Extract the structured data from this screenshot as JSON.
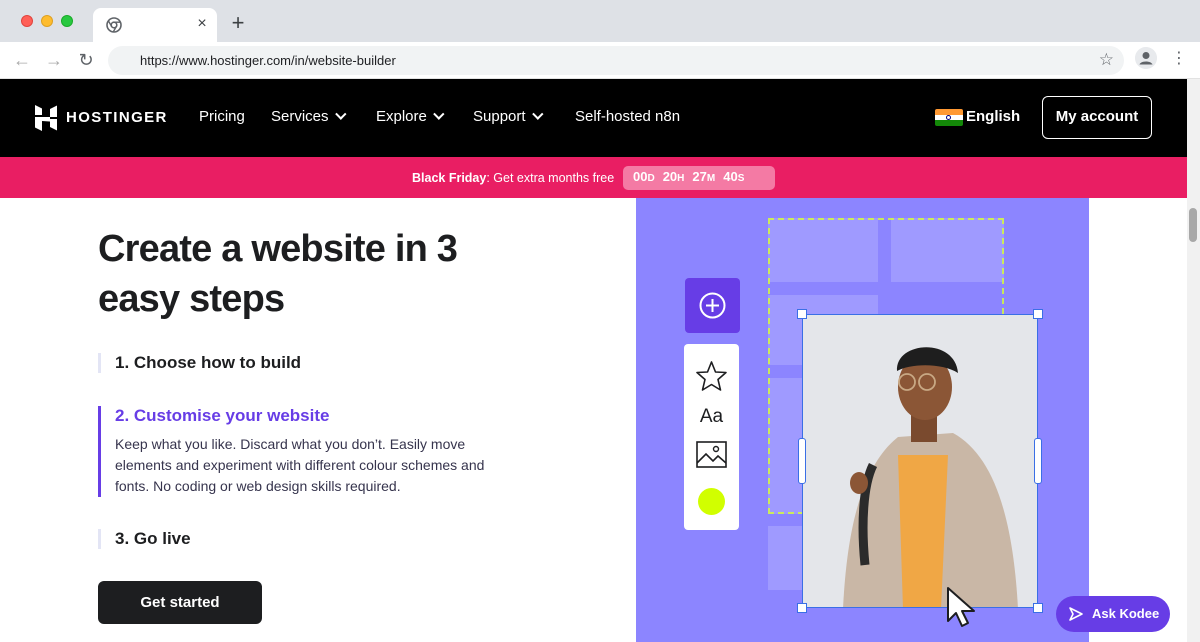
{
  "browser": {
    "url": "https://www.hostinger.com/in/website-builder",
    "tab_close": "×",
    "new_tab": "+"
  },
  "header": {
    "logo_text": "HOSTINGER",
    "nav": [
      {
        "label": "Pricing"
      },
      {
        "label": "Services"
      },
      {
        "label": "Explore"
      },
      {
        "label": "Support"
      },
      {
        "label": "Self-hosted n8n"
      }
    ],
    "language": "English",
    "account_label": "My account"
  },
  "promo": {
    "bold": "Black Friday",
    "text": ": Get extra months free",
    "countdown": [
      {
        "value": "00",
        "unit": "D"
      },
      {
        "value": "20",
        "unit": "H"
      },
      {
        "value": "27",
        "unit": "M"
      },
      {
        "value": "40",
        "unit": "S"
      }
    ]
  },
  "hero": {
    "title": "Create a website in 3 easy steps",
    "steps": [
      {
        "title": "1. Choose how to build"
      },
      {
        "title": "2. Customise your website",
        "desc": "Keep what you like. Discard what you don’t. Easily move elements and experiment with different colour schemes and fonts. No coding or web design skills required."
      },
      {
        "title": "3. Go live"
      }
    ],
    "cta": "Get started"
  },
  "editor_tools": {
    "text_tool": "Aa"
  },
  "kodee": {
    "label": "Ask Kodee"
  },
  "colors": {
    "brand_purple": "#673de6",
    "promo_pink": "#e91e63",
    "illustration_bg": "#8c85ff",
    "lime_accent": "#d1ff00"
  }
}
